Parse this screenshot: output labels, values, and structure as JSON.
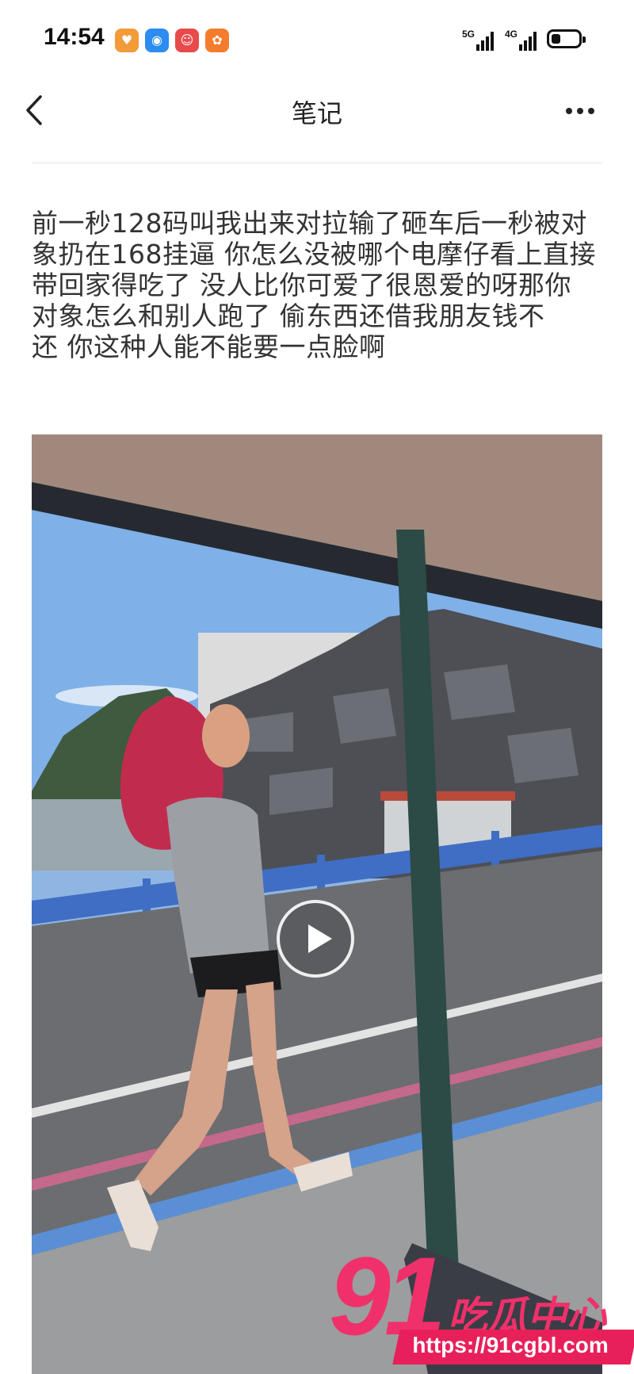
{
  "status_bar": {
    "time": "14:54",
    "app_icons": [
      "heart-app-icon",
      "signal-app-icon",
      "clown-app-icon",
      "orange-app-icon"
    ],
    "network": [
      "5G",
      "4G"
    ],
    "battery_level": 0.35
  },
  "nav": {
    "title": "笔记",
    "back_icon": "chevron-left-icon",
    "more_icon": "more-dots-icon"
  },
  "post": {
    "text": "前一秒128码叫我出来对拉输了砸车后一秒被对\n象扔在168挂逼 你怎么没被哪个电摩仔看上直接\n带回家得吃了 没人比你可爱了很恩爱的呀那你\n对象怎么和别人跑了 偷东西还借我朋友钱不\n还 你这种人能不能要一点脸啊"
  },
  "video": {
    "play_icon": "play-icon"
  },
  "watermark": {
    "number": "91",
    "label": "吃瓜中心",
    "url": "https://91cgbl.com"
  }
}
